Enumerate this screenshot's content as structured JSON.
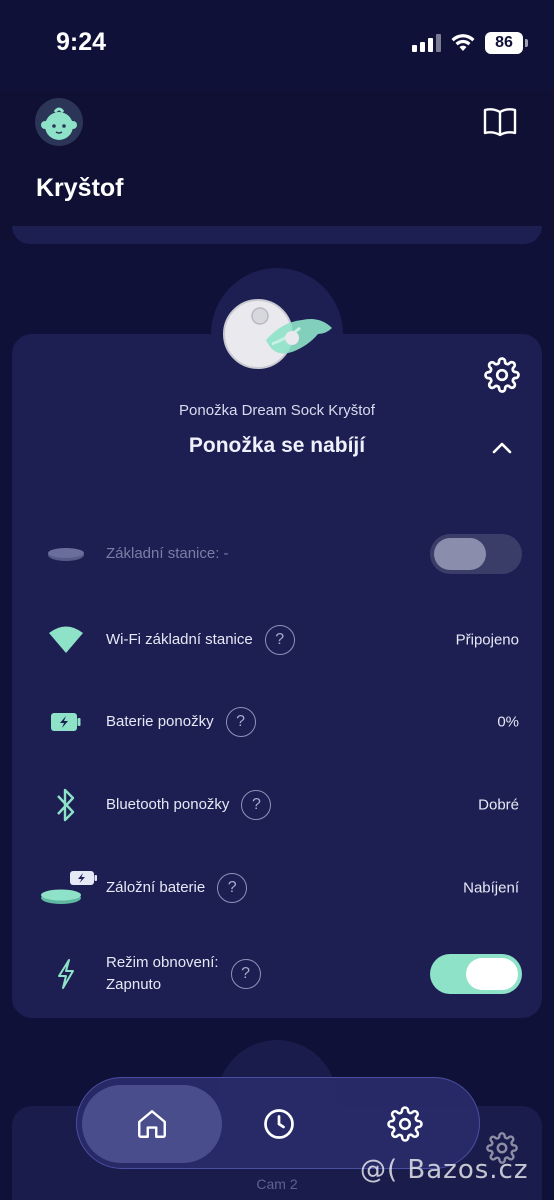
{
  "status_bar": {
    "time": "9:24",
    "battery": "86"
  },
  "header": {
    "child_name": "Kryštof"
  },
  "device": {
    "name": "Ponožka Dream Sock Kryštof",
    "status": "Ponožka se nabíjí"
  },
  "rows": [
    {
      "label": "Základní stanice: -",
      "value": "",
      "icon": "base-station-icon",
      "toggle": "off",
      "help": false
    },
    {
      "label": "Wi-Fi základní stanice",
      "value": "Připojeno",
      "icon": "wifi-icon",
      "help": true
    },
    {
      "label": "Baterie ponožky",
      "value": "0%",
      "icon": "battery-charging-icon",
      "help": true
    },
    {
      "label": "Bluetooth ponožky",
      "value": "Dobré",
      "icon": "bluetooth-icon",
      "help": true
    },
    {
      "label": "Záložní baterie",
      "value": "Nabíjení",
      "icon": "backup-battery-icon",
      "help": true
    },
    {
      "label_line1": "Režim obnovení:",
      "label_line2": "Zapnuto",
      "icon": "lightning-icon",
      "toggle": "on",
      "help": true
    }
  ],
  "help_glyph": "?",
  "lower_card": {
    "label": "Cam 2"
  },
  "tabs": [
    {
      "name": "home",
      "icon": "home-icon",
      "active": true
    },
    {
      "name": "history",
      "icon": "clock-icon",
      "active": false
    },
    {
      "name": "settings",
      "icon": "gear-icon",
      "active": false
    }
  ],
  "watermark": "@( Bazos.cz",
  "colors": {
    "background": "#101138",
    "card": "#1d1f52",
    "accent": "#8ee2c8",
    "tabbar": "#282b69"
  }
}
